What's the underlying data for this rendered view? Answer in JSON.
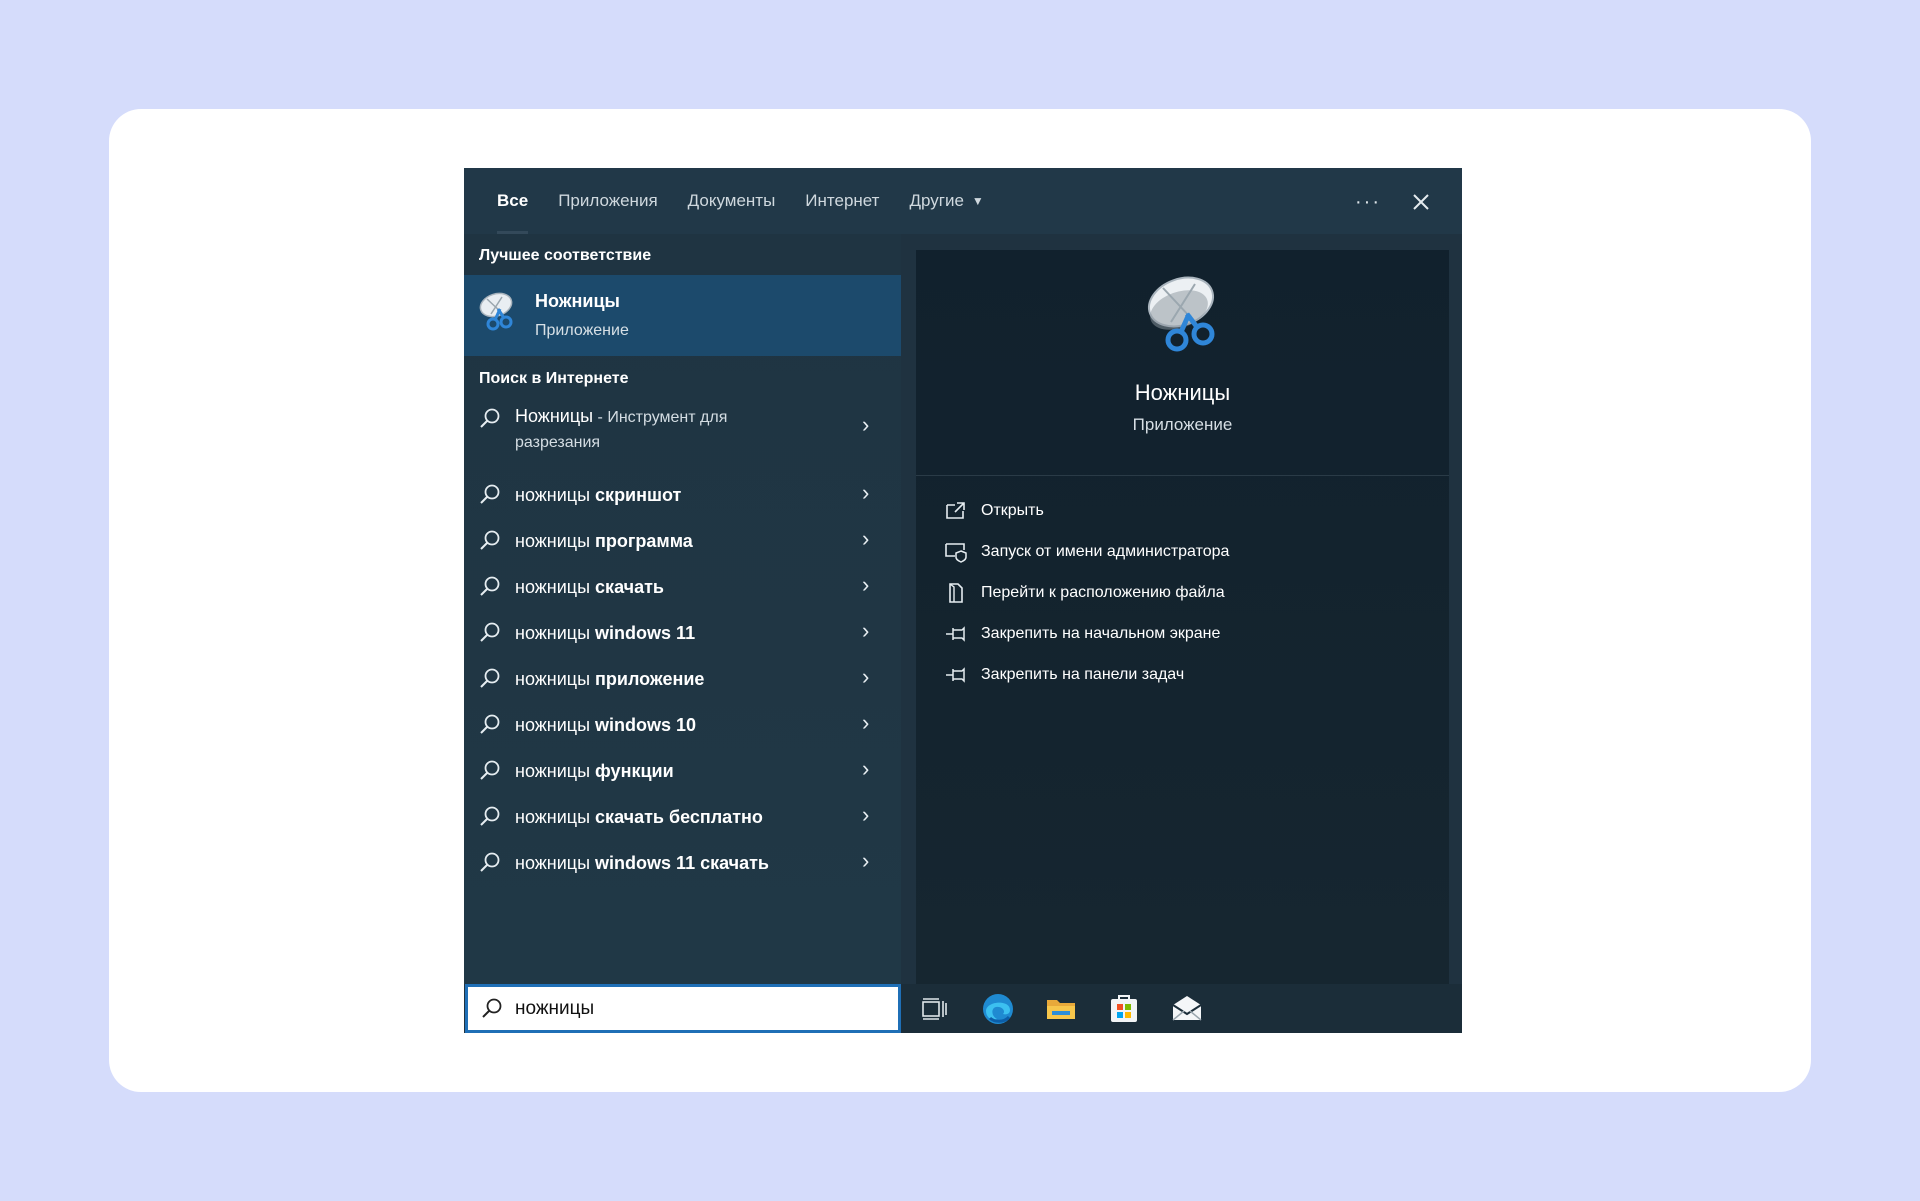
{
  "tabs": [
    {
      "label": "Все"
    },
    {
      "label": "Приложения"
    },
    {
      "label": "Документы"
    },
    {
      "label": "Интернет"
    },
    {
      "label": "Другие"
    }
  ],
  "header": {
    "more_icon": "more-icon",
    "close_icon": "close-icon"
  },
  "best_match": {
    "section_title": "Лучшее соответствие",
    "name": "Ножницы",
    "type": "Приложение",
    "icon": "snipping-tool-icon"
  },
  "web_search": {
    "section_title": "Поиск в Интернете",
    "first": {
      "query": "Ножницы",
      "suffix": " - Инструмент для",
      "suffix2": "разрезания"
    },
    "items": [
      {
        "query": "ножницы ",
        "rest": "скриншот"
      },
      {
        "query": "ножницы ",
        "rest": "программа"
      },
      {
        "query": "ножницы ",
        "rest": "скачать"
      },
      {
        "query": "ножницы ",
        "rest": "windows 11"
      },
      {
        "query": "ножницы ",
        "rest": "приложение"
      },
      {
        "query": "ножницы ",
        "rest": "windows 10"
      },
      {
        "query": "ножницы ",
        "rest": "функции"
      },
      {
        "query": "ножницы ",
        "rest": "скачать бесплатно"
      },
      {
        "query": "ножницы ",
        "rest": "windows 11 скачать"
      }
    ]
  },
  "detail": {
    "name": "Ножницы",
    "type": "Приложение",
    "actions": [
      {
        "label": "Открыть",
        "icon": "open-icon"
      },
      {
        "label": "Запуск от имени администратора",
        "icon": "run-as-admin-icon"
      },
      {
        "label": "Перейти к расположению файла",
        "icon": "file-location-icon"
      },
      {
        "label": "Закрепить на начальном экране",
        "icon": "pin-icon"
      },
      {
        "label": "Закрепить на панели задач",
        "icon": "pin-icon"
      }
    ]
  },
  "search": {
    "value": "ножницы"
  },
  "taskbar": [
    "task-view-icon",
    "edge-icon",
    "file-explorer-icon",
    "store-icon",
    "mail-icon"
  ],
  "colors": {
    "accent": "#1f6fb6",
    "selected": "#1c4a6c",
    "panel": "#1f3240"
  }
}
